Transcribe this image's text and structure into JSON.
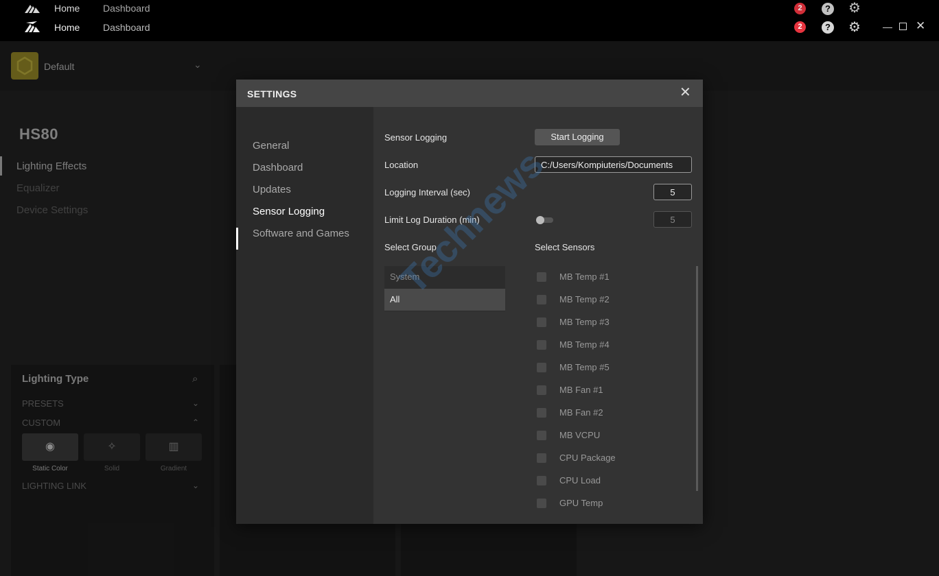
{
  "titlebar": {
    "nav": [
      "Home",
      "Dashboard"
    ],
    "badge_count": "2",
    "help_icon": "?",
    "settings_icon": "gear-icon",
    "window_controls": [
      "minimize-icon",
      "maximize-icon",
      "close-icon"
    ]
  },
  "profile": {
    "name": "Default"
  },
  "device": {
    "name": "HS80",
    "nav": [
      "Lighting Effects",
      "Equalizer",
      "Device Settings"
    ]
  },
  "lighting": {
    "title": "Lighting Type",
    "sections": [
      "PRESETS",
      "CUSTOM",
      "LIGHTING LINK"
    ],
    "types": [
      "Static Color",
      "Solid",
      "Gradient"
    ]
  },
  "dialog": {
    "title": "SETTINGS",
    "side_items": [
      "General",
      "Dashboard",
      "Updates",
      "Sensor Logging",
      "Software and Games"
    ],
    "sensor_logging_label": "Sensor Logging",
    "start_button": "Start Logging",
    "location_label": "Location",
    "location_value": "C:/Users/Kompiuteris/Documents",
    "interval_label": "Logging Interval (sec)",
    "interval_value": "5",
    "limit_label": "Limit Log Duration (min)",
    "limit_value": "5",
    "select_group_label": "Select Group",
    "select_sensors_label": "Select Sensors",
    "groups": [
      "System",
      "All"
    ],
    "sensors": [
      "MB Temp #1",
      "MB Temp #2",
      "MB Temp #3",
      "MB Temp #4",
      "MB Temp #5",
      "MB Fan #1",
      "MB Fan #2",
      "MB VCPU",
      "CPU Package",
      "CPU Load",
      "GPU Temp"
    ]
  },
  "watermark": "Technews"
}
